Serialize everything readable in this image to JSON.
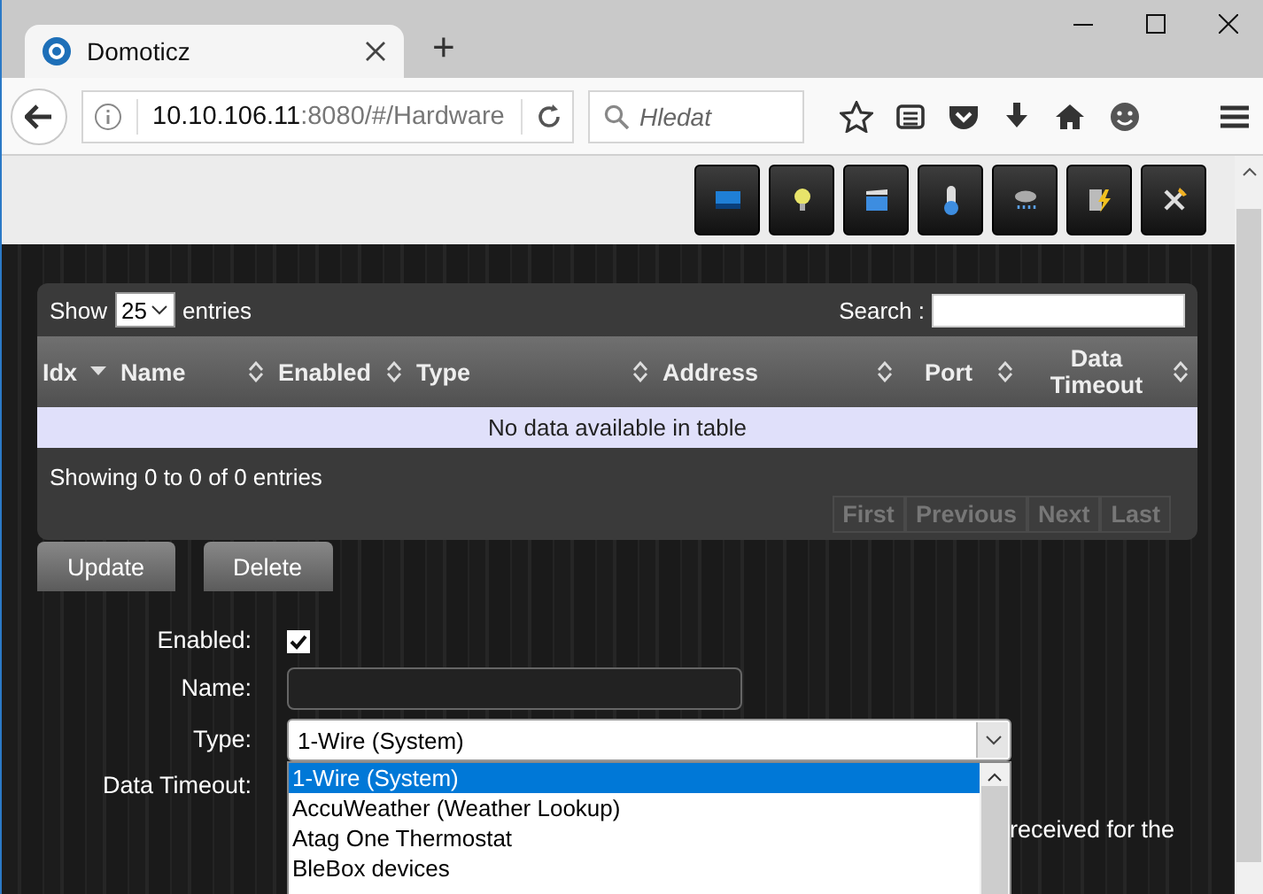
{
  "browser": {
    "tabs": [
      {
        "title": "Domoticz",
        "selected": true
      }
    ],
    "new_tab": "+",
    "url": {
      "host": "10.10.106.11",
      "path": ":8080/#/Hardware"
    },
    "search": {
      "placeholder": "Hledat"
    }
  },
  "table": {
    "length_label_before": "Show",
    "length_value": "25",
    "length_label_after": "entries",
    "search_label": "Search :",
    "columns": [
      {
        "label": "Idx",
        "sorted": true
      },
      {
        "label": "Name",
        "sorted": false
      },
      {
        "label": "Enabled",
        "sorted": false
      },
      {
        "label": "Type",
        "sorted": false
      },
      {
        "label": "Address",
        "sorted": false
      },
      {
        "label": "Port",
        "sorted": false
      },
      {
        "label": "Data Timeout",
        "sorted": false
      }
    ],
    "empty_message": "No data available in table",
    "info": "Showing 0 to 0 of 0 entries",
    "pagination": [
      {
        "label": "First",
        "disabled": true
      },
      {
        "label": "Previous",
        "disabled": true
      },
      {
        "label": "Next",
        "disabled": true
      },
      {
        "label": "Last",
        "disabled": true
      }
    ]
  },
  "buttons": [
    "Update",
    "Delete"
  ],
  "form": {
    "enabled_label": "Enabled:",
    "enabled": true,
    "name_label": "Name:",
    "type_label": "Type:",
    "type_value": "1-Wire (System)",
    "timeout_label": "Data Timeout:",
    "timeout_help": "received for the",
    "type_options": [
      {
        "label": "1-Wire (System)",
        "selected": true
      },
      {
        "label": "AccuWeather (Weather Lookup)",
        "selected": false
      },
      {
        "label": "Atag One Thermostat",
        "selected": false
      },
      {
        "label": "BleBox devices",
        "selected": false
      }
    ]
  }
}
